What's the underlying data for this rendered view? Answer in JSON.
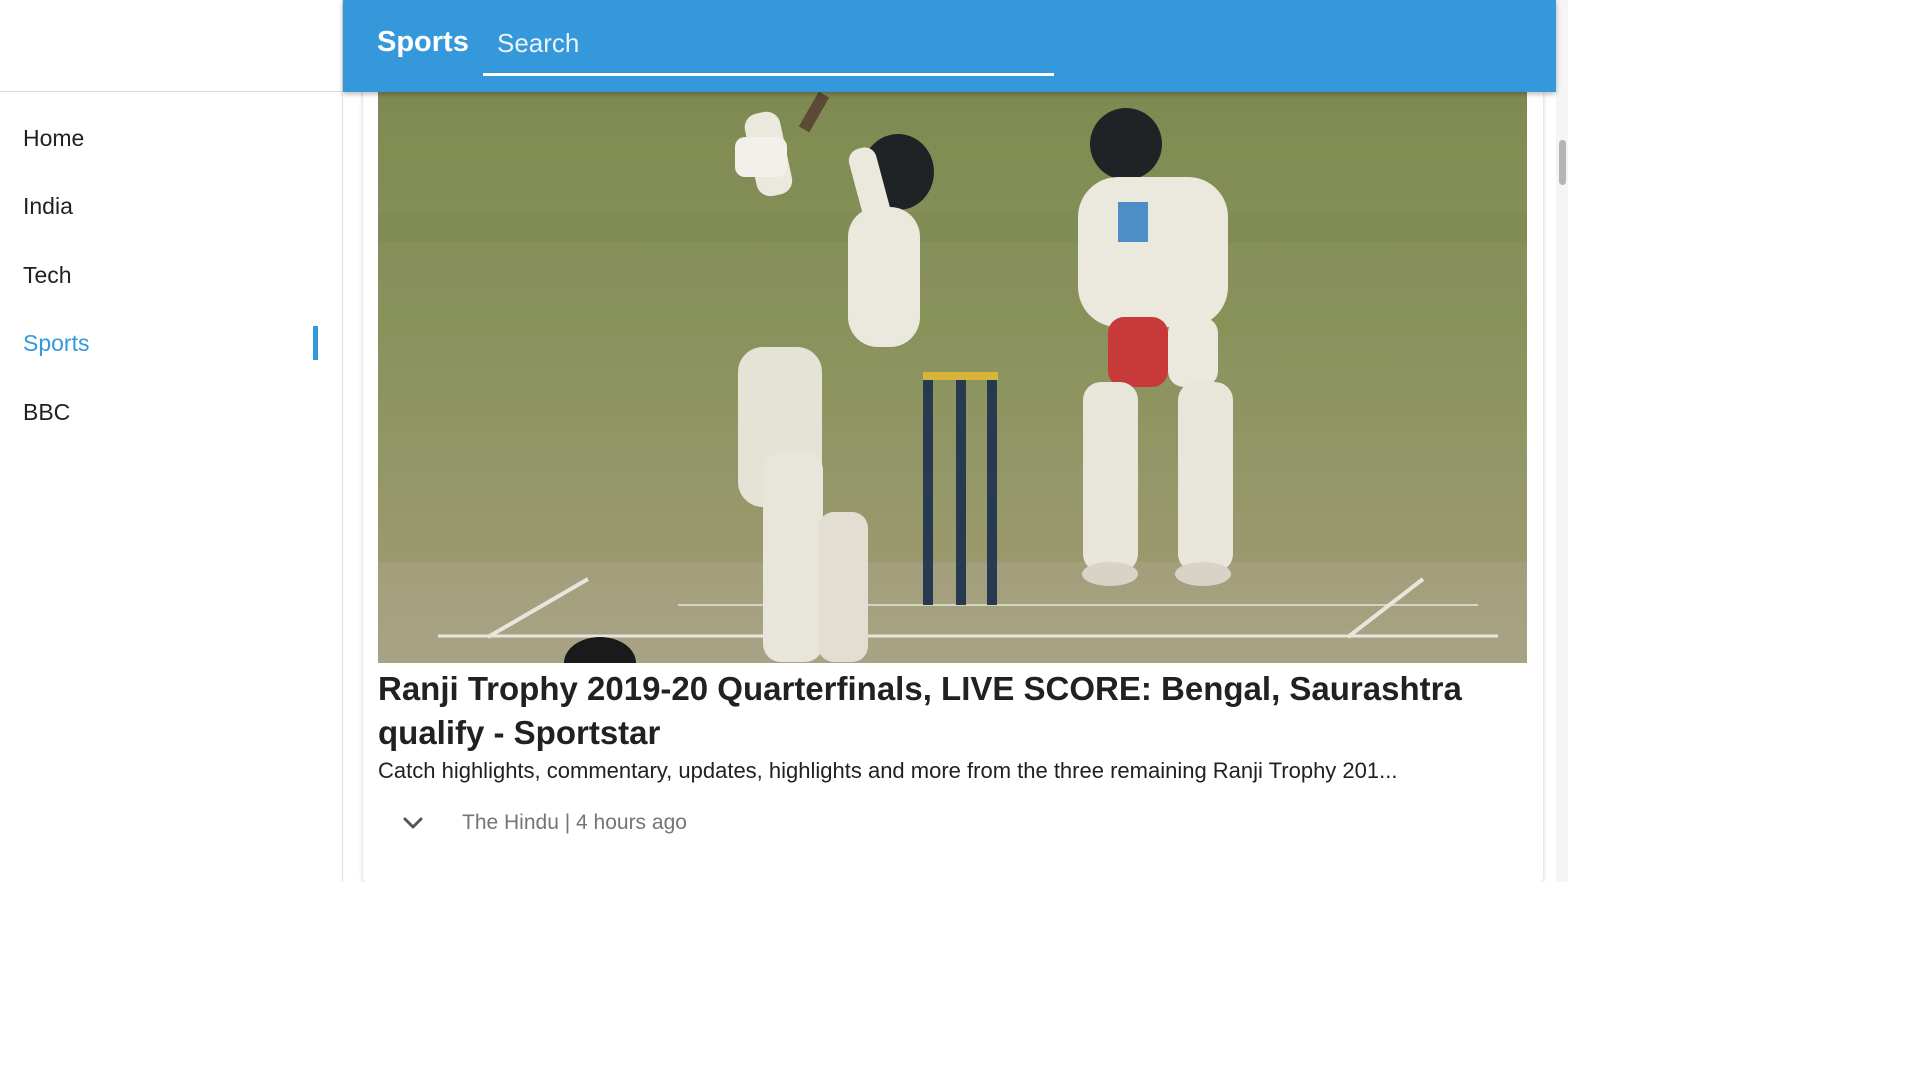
{
  "sidebar": {
    "items": [
      {
        "label": "Home",
        "active": false
      },
      {
        "label": "India",
        "active": false
      },
      {
        "label": "Tech",
        "active": false
      },
      {
        "label": "Sports",
        "active": true
      },
      {
        "label": "BBC",
        "active": false
      }
    ]
  },
  "header": {
    "title": "Sports",
    "search_placeholder": "Search"
  },
  "article": {
    "headline": "Ranji Trophy 2019-20 Quarterfinals, LIVE SCORE: Bengal, Saurashtra qualify - Sportstar",
    "description": "Catch highlights, commentary, updates, highlights and more from the three remaining Ranji Trophy 201...",
    "source_line": "The Hindu | 4 hours ago",
    "expand_icon": "chevron-down-icon"
  },
  "colors": {
    "accent": "#3498db",
    "text": "#212121",
    "muted": "#757575"
  }
}
